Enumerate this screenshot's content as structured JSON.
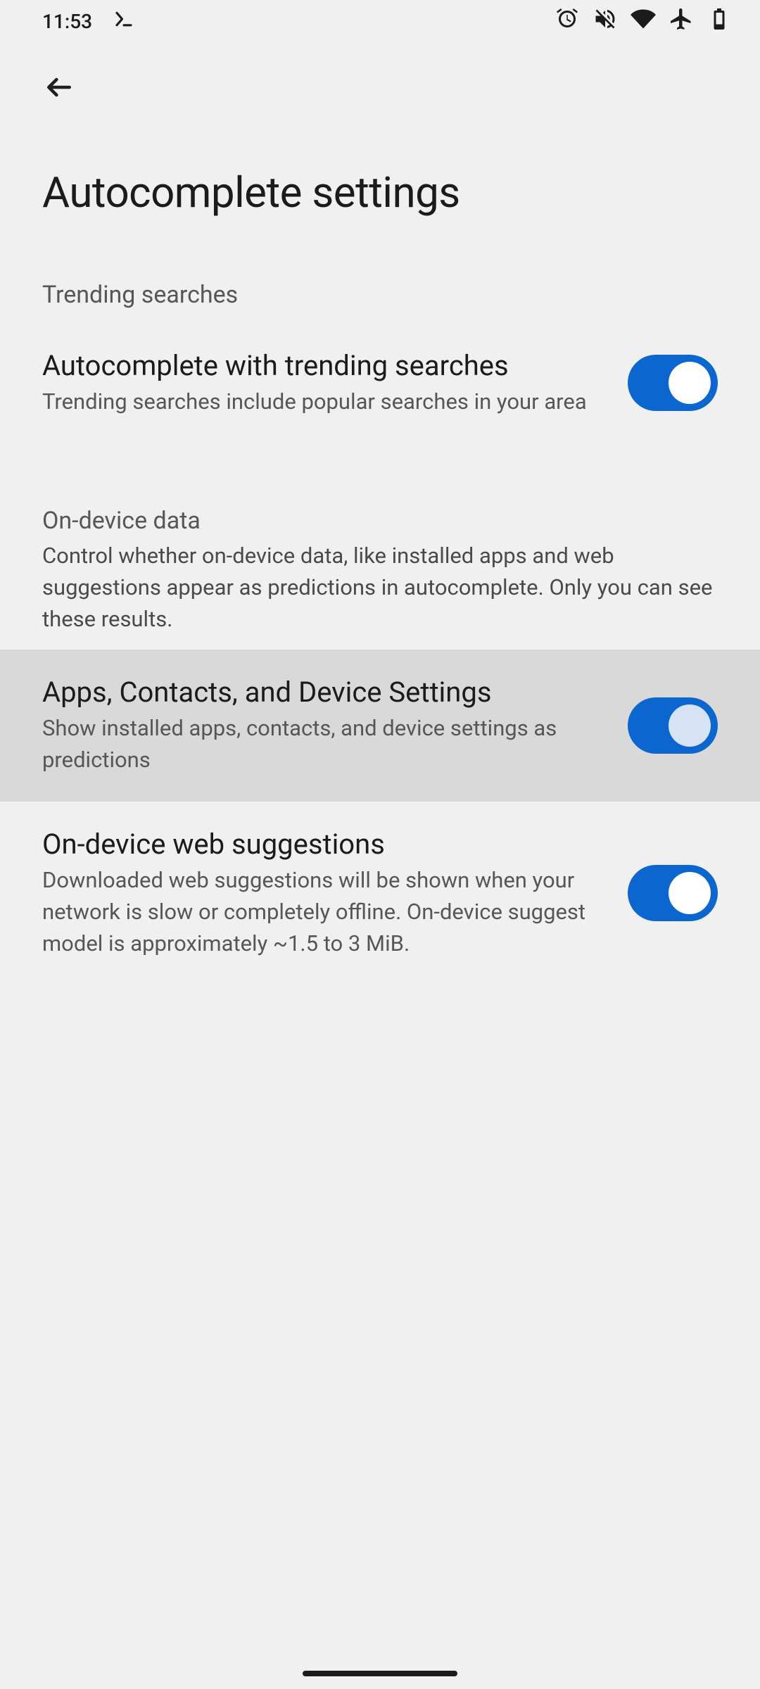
{
  "status": {
    "time": "11:53"
  },
  "header": {
    "title": "Autocomplete settings"
  },
  "sections": [
    {
      "id": "trending",
      "title": "Trending searches",
      "desc": null,
      "items": [
        {
          "id": "trending-toggle",
          "title": "Autocomplete with trending searches",
          "subtitle": "Trending searches include popular searches in your area",
          "on": true,
          "highlighted": false,
          "dim": false
        }
      ]
    },
    {
      "id": "ondevice",
      "title": "On-device data",
      "desc": "Control whether on-device data, like installed apps and web suggestions appear as predictions in autocomplete. Only you can see these results.",
      "items": [
        {
          "id": "apps-contacts-toggle",
          "title": "Apps, Contacts, and Device Settings",
          "subtitle": "Show installed apps, contacts, and device settings as predictions",
          "on": true,
          "highlighted": true,
          "dim": true
        },
        {
          "id": "web-suggestions-toggle",
          "title": "On-device web suggestions",
          "subtitle": "Downloaded web suggestions will be shown when your network is slow or completely offline. On-device suggest model is approximately ~1.5 to 3 MiB.",
          "on": true,
          "highlighted": false,
          "dim": false
        }
      ]
    }
  ]
}
